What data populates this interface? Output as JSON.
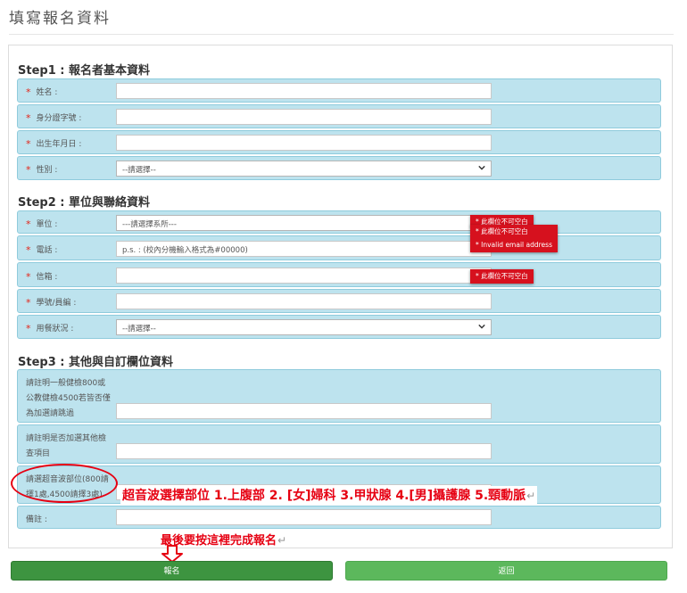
{
  "page_title": "填寫報名資料",
  "step1": {
    "heading": "Step1 : 報名者基本資料",
    "name_label": "姓名 :",
    "id_label": "身分證字號 :",
    "birth_label": "出生年月日 :",
    "gender_label": "性別 :",
    "gender_value": "--請選擇--"
  },
  "step2": {
    "heading": "Step2 : 單位與聯絡資料",
    "unit_label": "單位 :",
    "unit_value": "---請選擇系所---",
    "phone_label": "電話 :",
    "phone_placeholder": "p.s. : (校內分機輸入格式為#00000)",
    "email_label": "信箱 :",
    "studentid_label": "學號/員編 :",
    "meal_label": "用餐狀況 :",
    "meal_value": "--請選擇--",
    "tooltips": {
      "unit_required": "* 此欄位不可空白",
      "phone_required": "* 此欄位不可空白",
      "invalid_email": "* Invalid email address",
      "email_required": "* 此欄位不可空白"
    }
  },
  "step3": {
    "heading": "Step3 : 其他與自訂欄位資料",
    "checkup_lines": [
      "請註明一般健檢800或",
      "公教健檢4500若皆否僅",
      "為加選請跳過"
    ],
    "extra_lines": [
      "請註明是否加選其他檢",
      "查項目"
    ],
    "ultrasound_lines": [
      "請選超音波部位(800請",
      "擇1處,4500請擇3處)"
    ],
    "remark_label": "備註 :"
  },
  "annotations": {
    "ultrasound_hint": "超音波選擇部位 1.上腹部 2. [女]婦科 3.甲狀腺 4.[男]攝護腺 5.頸動脈",
    "submit_hint": "最後要按這裡完成報名",
    "return_mark": "↵"
  },
  "buttons": {
    "submit": "報名",
    "back": "返回"
  },
  "colors": {
    "row_bg": "#bde3ee",
    "required_star": "#e3261a",
    "tooltip": "#d6111e",
    "submit_button": "#3d9440",
    "back_button": "#5cb85c",
    "annotation": "#e60012"
  }
}
